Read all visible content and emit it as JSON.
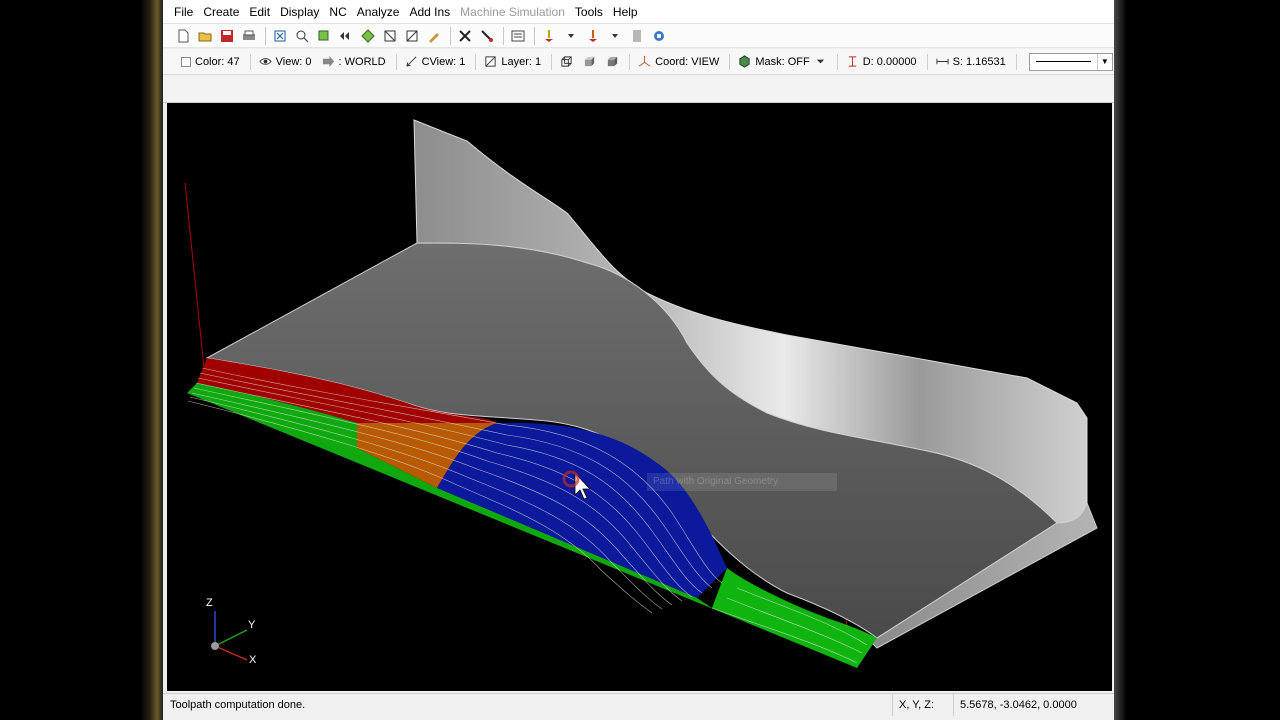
{
  "menu": [
    "File",
    "Create",
    "Edit",
    "Display",
    "NC",
    "Analyze",
    "Add Ins",
    "Machine Simulation",
    "Tools",
    "Help"
  ],
  "menu_disabled": [
    "Machine Simulation"
  ],
  "toolbar_icons": [
    "new-file-icon",
    "open-folder-icon",
    "save-icon",
    "print-icon",
    "fit-screen-icon",
    "unzoom-icon",
    "zoom-window-icon",
    "previous-view-icon",
    "gview-top-icon",
    "gview-front-icon",
    "gview-side-icon",
    "clear-colors-icon",
    "delete-icon",
    "undelete-icon",
    "hide-icon",
    "toolpath-verify-icon",
    "backplot-icon",
    "machine-icon",
    "simulate-icon"
  ],
  "statusbar": {
    "color": "Color: 47",
    "view": "View: 0",
    "world": ": WORLD",
    "cview": "CView: 1",
    "layer": "Layer: 1",
    "coord": "Coord: VIEW",
    "mask": "Mask: OFF",
    "depth": "D: 0.00000",
    "spacing": "S: 1.16531"
  },
  "viewport": {
    "tooltip": "Path with Original Geometry",
    "axis_z": "Z",
    "axis_y": "Y",
    "axis_x": "X"
  },
  "status": {
    "message": "Toolpath computation done.",
    "xyz_label": "X, Y, Z:",
    "xyz_value": "5.5678, -3.0462, 0.0000"
  },
  "colors": {
    "toolpath_red": "#b00000",
    "toolpath_orange": "#c85a00",
    "toolpath_blue": "#0a1a9a",
    "toolpath_green": "#0fb40f",
    "surface": "#5a5a5a"
  }
}
